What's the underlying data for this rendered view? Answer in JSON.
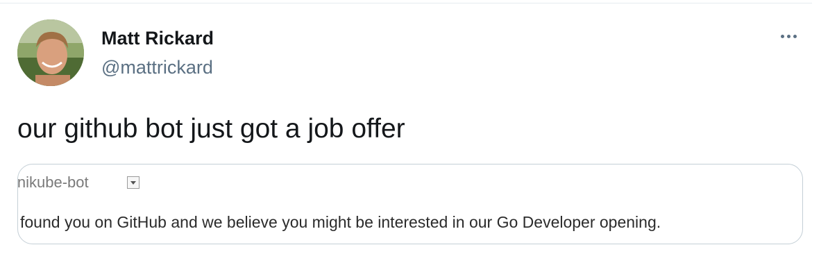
{
  "tweet": {
    "author": {
      "display_name": "Matt Rickard",
      "handle": "@mattrickard",
      "avatar_icon": "profile-photo"
    },
    "more_icon": "ellipsis-icon",
    "text": "our github bot just got a job offer"
  },
  "media": {
    "sender": "inikube-bot",
    "body": "found you on GitHub and we believe you might be interested in our Go Developer opening."
  },
  "colors": {
    "name": "#14171a",
    "handle": "#5b7083",
    "border": "#c4cfd6"
  }
}
